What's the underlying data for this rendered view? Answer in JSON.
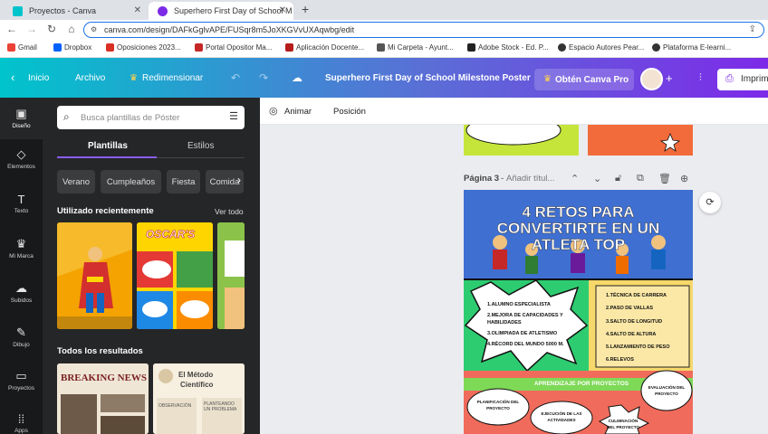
{
  "browser": {
    "tabs": [
      {
        "title": "Proyectos - Canva",
        "active": false
      },
      {
        "title": "Superhero First Day of School M",
        "active": true
      }
    ],
    "new_tab": "+",
    "url": "canva.com/design/DAFkGglvAPE/FUSqr8m5JoXKGVvUXAqwbg/edit",
    "bookmarks": [
      "Gmail",
      "Dropbox",
      "Oposiciones 2023...",
      "Portal Opositor Ma...",
      "Aplicación Docente...",
      "Mi Carpeta - Ayunt...",
      "Adobe Stock - Ed. P...",
      "Espacio Autores Pear...",
      "Plataforma E-learni..."
    ]
  },
  "header": {
    "home": "Inicio",
    "file": "Archivo",
    "resize": "Redimensionar",
    "title": "Superhero First Day of School Milestone Poster",
    "pro": "Obtén Canva Pro",
    "plus": "+",
    "print": "Imprim"
  },
  "rail": [
    {
      "label": "Diseño",
      "icon": "▣"
    },
    {
      "label": "Elementos",
      "icon": "◇"
    },
    {
      "label": "Texto",
      "icon": "T"
    },
    {
      "label": "Mi Marca",
      "icon": "♛"
    },
    {
      "label": "Subidos",
      "icon": "☁"
    },
    {
      "label": "Dibujo",
      "icon": "✎"
    },
    {
      "label": "Proyectos",
      "icon": "▭"
    },
    {
      "label": "Apps",
      "icon": "⁞⁞"
    }
  ],
  "panel": {
    "search_placeholder": "Busca plantillas de Póster",
    "tabs": [
      "Plantillas",
      "Estilos"
    ],
    "chips": [
      "Verano",
      "Cumpleaños",
      "Fiesta",
      "Comida"
    ],
    "recent_title": "Utilizado recientemente",
    "see_all": "Ver todo",
    "results_title": "Todos los resultados",
    "thumb_texts": {
      "oscar": "OSCAR'S",
      "breaking": "BREAKING NEWS",
      "metodo1": "El Método",
      "metodo2": "Científico",
      "obs": "OBSERVACIÓN",
      "plant": "PLANTEANDO UN PROBLEMA"
    }
  },
  "toolbar": {
    "animate": "Animar",
    "position": "Posición"
  },
  "page": {
    "label": "Página 3",
    "title_placeholder": "Añadir títul..."
  },
  "poster": {
    "title": "4 RETOS PARA CONVERTIRTE EN UN ATLETA TOP",
    "left_list": [
      "1.ALUMNO ESPECIALISTA",
      "2.MEJORA DE CAPACIDADES Y HABILIDADES",
      "3.OLIMPIADA DE ATLETISMO",
      "4.RÉCORD DEL MUNDO 5000 M."
    ],
    "right_list": [
      "1.TÉCNICA DE CARRERA",
      "2.PASO DE VALLAS",
      "3.SALTO DE LONGITUD",
      "4.SALTO DE ALTURA",
      "5.LANZAMIENTO DE PESO",
      "6.RELEVOS"
    ],
    "bottom_title": "APRENDIZAJE POR PROYECTOS",
    "bubbles": [
      "PLANIFICACIÓN DEL PROYECTO",
      "EJECUCIÓN DE LAS ACTIVIDADES",
      "EVALUACIÓN DEL PROYECTO",
      "CULMINACIÓN DEL PROYECTO"
    ]
  },
  "colors": {
    "accent": "#7d2ae8",
    "teal": "#00c4cc",
    "poster_blue": "#3f6fd1",
    "poster_green": "#2ecc71",
    "poster_yellow": "#f6d86b",
    "poster_red": "#f06b5b"
  }
}
